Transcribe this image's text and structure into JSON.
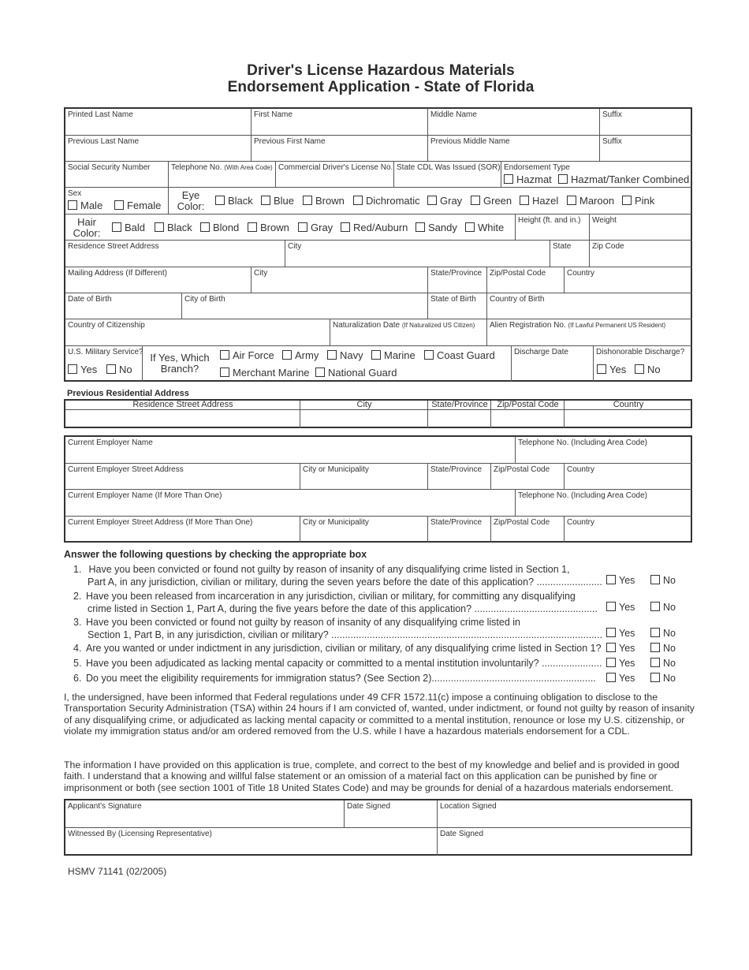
{
  "title": {
    "line1": "Driver's License Hazardous Materials",
    "line2": "Endorsement Application - State of Florida"
  },
  "personal": {
    "printed_last_name": "Printed Last Name",
    "first_name": "First Name",
    "middle_name": "Middle Name",
    "suffix": "Suffix",
    "previous_last_name": "Previous Last Name",
    "previous_first_name": "Previous First Name",
    "previous_middle_name": "Previous Middle Name",
    "previous_suffix": "Suffix",
    "ssn": "Social Security Number",
    "telephone": "Telephone No.",
    "telephone_note": "(With Area Code)",
    "cdl_no": "Commercial Driver's License No.",
    "state_cdl": "State CDL Was Issued (SOR)",
    "endorsement_type": "Endorsement Type",
    "endorsement_options": [
      "Hazmat",
      "Hazmat/Tanker Combined"
    ],
    "sex": "Sex",
    "sex_options": [
      "Male",
      "Female"
    ],
    "eye_color_label_1": "Eye",
    "eye_color_label_2": "Color:",
    "eye_color_options": [
      "Black",
      "Blue",
      "Brown",
      "Dichromatic",
      "Gray",
      "Green",
      "Hazel",
      "Maroon",
      "Pink"
    ],
    "hair_color_label_1": "Hair",
    "hair_color_label_2": "Color:",
    "hair_color_options": [
      "Bald",
      "Black",
      "Blond",
      "Brown",
      "Gray",
      "Red/Auburn",
      "Sandy",
      "White"
    ],
    "height": "Height (ft. and in.)",
    "weight": "Weight",
    "residence_street": "Residence Street Address",
    "residence_city": "City",
    "residence_state": "State",
    "residence_zip": "Zip Code",
    "mailing_address": "Mailing Address (If Different)",
    "mailing_city": "City",
    "mailing_state": "State/Province",
    "mailing_zip": "Zip/Postal Code",
    "mailing_country": "Country",
    "dob": "Date of Birth",
    "city_of_birth": "City of Birth",
    "state_of_birth": "State of Birth",
    "country_of_birth": "Country of Birth",
    "citizenship": "Country of Citizenship",
    "naturalization_date": "Naturalization Date",
    "naturalization_note": "(If Naturalized US Citizen)",
    "alien_reg": "Alien Registration No.",
    "alien_reg_note": "(If Lawful Permanent US Resident)",
    "military_service": "U.S. Military Service?",
    "military_options": [
      "Yes",
      "No"
    ],
    "branch_label_1": "If Yes, Which",
    "branch_label_2": "Branch?",
    "branch_options_row1": [
      "Air Force",
      "Army",
      "Navy",
      "Marine",
      "Coast Guard"
    ],
    "branch_options_row2": [
      "Merchant Marine",
      "National Guard"
    ],
    "discharge_date": "Discharge Date",
    "dishonorable_discharge": "Dishonorable Discharge?",
    "dishonorable_options": [
      "Yes",
      "No"
    ]
  },
  "previous_address": {
    "heading": "Previous Residential Address",
    "columns": [
      "Residence Street Address",
      "City",
      "State/Province",
      "Zip/Postal Code",
      "Country"
    ]
  },
  "employer": {
    "name": "Current Employer Name",
    "telephone": "Telephone No. (Including Area Code)",
    "street": "Current Employer Street Address",
    "city": "City or Municipality",
    "state": "State/Province",
    "zip": "Zip/Postal Code",
    "country": "Country",
    "name2": "Current Employer Name (If More Than One)",
    "telephone2": "Telephone No. (Including Area Code)",
    "street2": "Current Employer Street Address (If More Than One)",
    "city2": "City or Municipality",
    "state2": "State/Province",
    "zip2": "Zip/Postal Code",
    "country2": "Country"
  },
  "questions": {
    "heading": "Answer the following questions by checking the appropriate box",
    "yes": "Yes",
    "no": "No",
    "items": [
      {
        "num": "1.",
        "line1": "Have you been convicted or found not guilty by reason of insanity of any disqualifying crime listed in Section 1,",
        "line2": "Part A, in any jurisdiction, civilian or military, during the seven years before the date of this application? ........................"
      },
      {
        "num": "2.",
        "line1": "Have you been released from incarceration in any jurisdiction, civilian or military, for committing any disqualifying",
        "line2": "crime listed in Section 1, Part A, during the five years before the date of this application?  ............................................."
      },
      {
        "num": "3.",
        "line1": "Have you been convicted or found not guilty by reason of insanity of any disqualifying crime listed in",
        "line2": "Section 1, Part B, in any jurisdiction, civilian or military? ..................................................................................................."
      },
      {
        "num": "4.",
        "line1": "Are you wanted or under indictment in any jurisdiction, civilian or military, of any disqualifying crime listed in Section 1?",
        "line2": ""
      },
      {
        "num": "5.",
        "line1": "Have you been adjudicated as lacking mental capacity or committed to a mental institution involuntarily? ......................",
        "line2": ""
      },
      {
        "num": "6.",
        "line1": "Do you meet the eligibility requirements for immigration status?  (See Section 2)............................................................",
        "line2": ""
      }
    ]
  },
  "statements": {
    "obligation": "I, the undersigned, have been informed that Federal regulations under 49 CFR 1572.11(c) impose a continuing obligation to disclose to the Transportation Security Administration (TSA) within 24 hours if I am convicted of, wanted, under indictment, or found not guilty by reason of insanity of any disqualifying crime, or adjudicated as lacking mental capacity or committed to a mental institution, renounce or lose my U.S. citizenship, or violate my immigration status and/or am ordered removed from the U.S. while I have a hazardous materials endorsement for a CDL.",
    "certification": "The information I have provided on this application is true, complete, and correct to the best of my knowledge and belief and is provided in good faith.  I understand that a knowing and willful false statement or an omission of a material fact on this application can be punished by fine or imprisonment or both (see section 1001 of Title 18 United States Code) and may be grounds for denial of a hazardous materials endorsement."
  },
  "signature": {
    "applicant_signature": "Applicant's Signature",
    "date_signed": "Date Signed",
    "location_signed": "Location Signed",
    "witnessed_by": "Witnessed By (Licensing Representative)",
    "witness_date_signed": "Date Signed"
  },
  "footer": {
    "form_number": "HSMV 71141 (02/2005)"
  }
}
